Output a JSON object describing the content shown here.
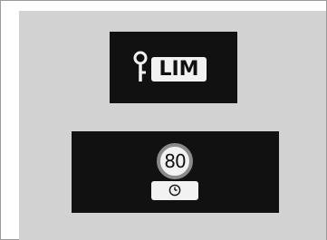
{
  "top_indicator": {
    "icon": "key-icon",
    "badge_text": "LIM"
  },
  "bottom_indicator": {
    "speed_limit": "80",
    "icon": "clock-icon"
  },
  "colors": {
    "panel_background": "#d2d2d2",
    "indicator_background": "#111111",
    "symbol_foreground": "#f2f2f2",
    "sign_ring": "#8a8a8a"
  }
}
